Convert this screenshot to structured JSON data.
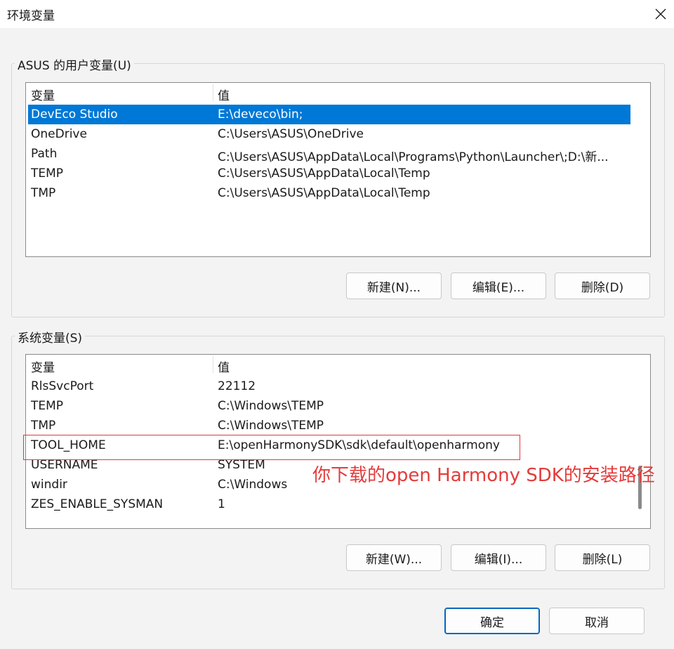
{
  "window": {
    "title": "环境变量"
  },
  "user_vars": {
    "legend": "ASUS 的用户变量(U)",
    "header": {
      "name": "变量",
      "value": "值"
    },
    "rows": [
      {
        "name": "DevEco Studio",
        "value": "E:\\deveco\\bin;",
        "selected": true
      },
      {
        "name": "OneDrive",
        "value": "C:\\Users\\ASUS\\OneDrive"
      },
      {
        "name": "Path",
        "value": "C:\\Users\\ASUS\\AppData\\Local\\Programs\\Python\\Launcher\\;D:\\新..."
      },
      {
        "name": "TEMP",
        "value": "C:\\Users\\ASUS\\AppData\\Local\\Temp"
      },
      {
        "name": "TMP",
        "value": "C:\\Users\\ASUS\\AppData\\Local\\Temp"
      }
    ],
    "buttons": {
      "new": "新建(N)...",
      "edit": "编辑(E)...",
      "delete": "删除(D)"
    }
  },
  "system_vars": {
    "legend": "系统变量(S)",
    "header": {
      "name": "变量",
      "value": "值"
    },
    "rows": [
      {
        "name": "RlsSvcPort",
        "value": "22112"
      },
      {
        "name": "TEMP",
        "value": "C:\\Windows\\TEMP"
      },
      {
        "name": "TMP",
        "value": "C:\\Windows\\TEMP"
      },
      {
        "name": "TOOL_HOME",
        "value": "E:\\openHarmonySDK\\sdk\\default\\openharmony"
      },
      {
        "name": "USERNAME",
        "value": "SYSTEM"
      },
      {
        "name": "windir",
        "value": "C:\\Windows"
      },
      {
        "name": "ZES_ENABLE_SYSMAN",
        "value": "1"
      }
    ],
    "buttons": {
      "new": "新建(W)...",
      "edit": "编辑(I)...",
      "delete": "删除(L)"
    }
  },
  "annotation": {
    "text": "你下载的open Harmony SDK的安装路径",
    "color": "#e43b3b"
  },
  "dialog_buttons": {
    "ok": "确定",
    "cancel": "取消"
  },
  "colors": {
    "selection": "#0078d7",
    "accent": "#0067c0"
  }
}
